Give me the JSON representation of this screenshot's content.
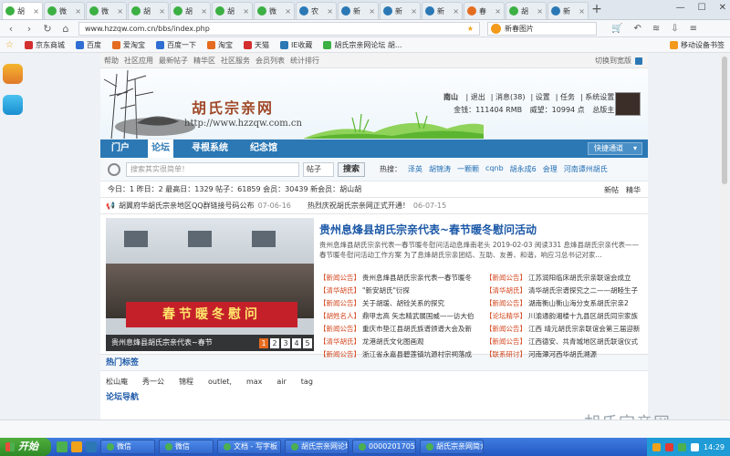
{
  "browser": {
    "tabs": [
      {
        "label": "胡",
        "color": "#3cb043",
        "active": true
      },
      {
        "label": "微",
        "color": "#3cb043"
      },
      {
        "label": "微",
        "color": "#3cb043"
      },
      {
        "label": "胡",
        "color": "#3cb043"
      },
      {
        "label": "胡",
        "color": "#3cb043"
      },
      {
        "label": "胡",
        "color": "#3cb043"
      },
      {
        "label": "微",
        "color": "#3cb043"
      },
      {
        "label": "农",
        "color": "#2b78b5"
      },
      {
        "label": "新",
        "color": "#2b78b5"
      },
      {
        "label": "新",
        "color": "#2b78b5"
      },
      {
        "label": "新",
        "color": "#2b78b5"
      },
      {
        "label": "春",
        "color": "#e56c1f"
      },
      {
        "label": "胡",
        "color": "#3cb043"
      },
      {
        "label": "新",
        "color": "#2b78b5"
      }
    ],
    "new_tab": "+",
    "url": "www.hzzqw.com.cn/bbs/index.php",
    "search_placeholder": "新春图片",
    "bookmarks": [
      "京东商城",
      "百度",
      "爱淘宝",
      "百度一下",
      "淘宝",
      "天猫",
      "IE收藏",
      "胡氏宗亲网论坛 胡..."
    ],
    "bookmark_right": "移动设备书签"
  },
  "site": {
    "topstrip": [
      "帮助",
      "社区应用",
      "最新帖子",
      "精华区",
      "社区服务",
      "会员列表",
      "统计排行"
    ],
    "topstrip_right": "切换到宽版",
    "logo_title": "胡氏宗亲网",
    "logo_url": "http://www.hzzqw.com.cn",
    "user": {
      "name": "南山",
      "links": [
        "退出",
        "消息(38)",
        "设置",
        "任务",
        "系统设置"
      ],
      "money": "金钱：111404 RMB",
      "prestige": "威望：10994 点",
      "rank": "总版主"
    },
    "nav": [
      "门户",
      "论坛",
      "寻根系统",
      "纪念馆"
    ],
    "nav_quick": "快捷通道",
    "search_input_placeholder": "搜索其实很简单！",
    "search_select": "帖子",
    "search_button": "搜索",
    "hot_label": "热搜：",
    "hot_words": [
      "泽英",
      "胡锦涛",
      "一颗颗",
      "cqnb",
      "胡永成6",
      "会理",
      "河南谭州胡氏"
    ],
    "stats": "今日：1  昨日：2  最高日：1329  帖子：61859  会员：30439  新会员：胡山胡",
    "stats_right": [
      "新帖",
      "精华"
    ],
    "notices": [
      {
        "text": "胡翼府华胡氏宗亲地区QQ群链接号码公布",
        "date": "07-06-16"
      },
      {
        "text": "热烈庆祝胡氏宗亲网正式开通！",
        "date": "06-07-15"
      }
    ],
    "feature": {
      "title": "贵州息烽县胡氏宗亲代表~春节暖冬慰问活动",
      "desc": "贵州息烽县胡氏宗亲代表一春节暖冬慰问活动息烽南老头 2019-02-03 阅读331 息烽县胡氏宗亲代表——春节暖冬慰问活动工作方案 为了息烽胡氏宗亲团结、互助、友善、和谐，响应习总书记对家...",
      "banner_text": "春节暖冬慰问",
      "caption": "贵州息烽县胡氏宗亲代表~春节",
      "pages": [
        "1",
        "2",
        "3",
        "4",
        "5"
      ],
      "items": [
        {
          "tag": "【新闻公告】",
          "text": "贵州息烽县胡氏宗亲代表一春节暖冬"
        },
        {
          "tag": "【新闻公告】",
          "text": "江苏润阳临床胡氏宗亲联谊会成立"
        },
        {
          "tag": "【清华胡氏】",
          "text": "\"新安胡氏\"衍探"
        },
        {
          "tag": "【清华胡氏】",
          "text": "清华胡氏宗谱探究之二——胡睦生子"
        },
        {
          "tag": "【新闻公告】",
          "text": "关于胡瑗、胡铨关系的探究"
        },
        {
          "tag": "【新闻公告】",
          "text": "湖南衡山衡山海分支系胡氏宗亲2"
        },
        {
          "tag": "【胡姓名人】",
          "text": "鼎甲志高 矢志精武展国威——访大伯"
        },
        {
          "tag": "【论坛精华】",
          "text": "川渝通韵湘楼十九县区胡氏同宗家族"
        },
        {
          "tag": "【新闻公告】",
          "text": "重庆市垫江县胡氏族谱颁谱大会及新"
        },
        {
          "tag": "【新闻公告】",
          "text": "江西 靖元胡氏宗亲联谊会第三届迎新"
        },
        {
          "tag": "【清华胡氏】",
          "text": "龙港胡氏文化图画观"
        },
        {
          "tag": "【新闻公告】",
          "text": "江西德安、共青城地区胡氏联谊仪式"
        },
        {
          "tag": "【新闻公告】",
          "text": "浙江省永嘉县碧莲镇坑源村宗祠落成"
        },
        {
          "tag": "【联系研讨】",
          "text": "河南潭河西华胡氏溯源"
        }
      ]
    },
    "hot_tags_label": "热门标签",
    "hot_tags": [
      "松山庵",
      "秀一公",
      "锦程",
      "outlet,",
      "max",
      "air",
      "tag"
    ],
    "next_section": "论坛导航"
  },
  "watermark": "胡氏宗亲网",
  "taskbar": {
    "start": "开始",
    "windows": [
      "微信",
      "微信",
      "文档 - 写字板",
      "胡氏宗亲网论坛",
      "0000201705(1)",
      "胡氏宗亲网简介"
    ],
    "time": "14:29"
  }
}
